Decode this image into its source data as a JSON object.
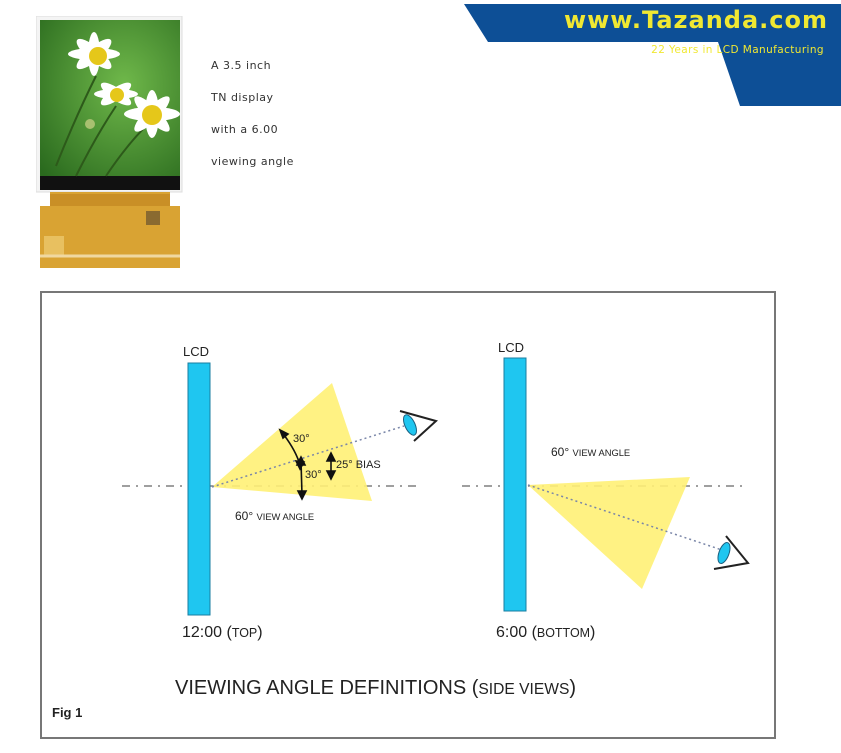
{
  "product": {
    "image_alt": "3.5 inch TN LCD module with daisy image",
    "description_lines": [
      "A 3.5 inch",
      "TN display",
      "with a 6.00",
      "viewing angle"
    ]
  },
  "banner": {
    "brand": "www.Tazanda.com",
    "tagline": "22 Years in LCD Manufacturing",
    "bg_color": "#0d4f96",
    "text_color": "#f0e832"
  },
  "figure": {
    "lcd_color": "#1fc6f0",
    "cone_color": "#fff176",
    "left": {
      "lcd_label": "LCD",
      "arc_top_label": "30°",
      "arc_bottom_label": "30°",
      "bias_label": "25° BIAS",
      "view_angle_label_num": "60°",
      "view_angle_label_text": "VIEW ANGLE",
      "caption_main": "12:00 (",
      "caption_sc": "TOP",
      "caption_end": ")"
    },
    "right": {
      "lcd_label": "LCD",
      "view_angle_label_num": "60°",
      "view_angle_label_text": "VIEW ANGLE",
      "caption_main": "6:00 (",
      "caption_sc": "BOTTOM",
      "caption_end": ")"
    },
    "title_main": "VIEWING ANGLE DEFINITIONS (",
    "title_sc": "SIDE VIEWS",
    "title_end": ")",
    "fig_label": "Fig 1"
  }
}
